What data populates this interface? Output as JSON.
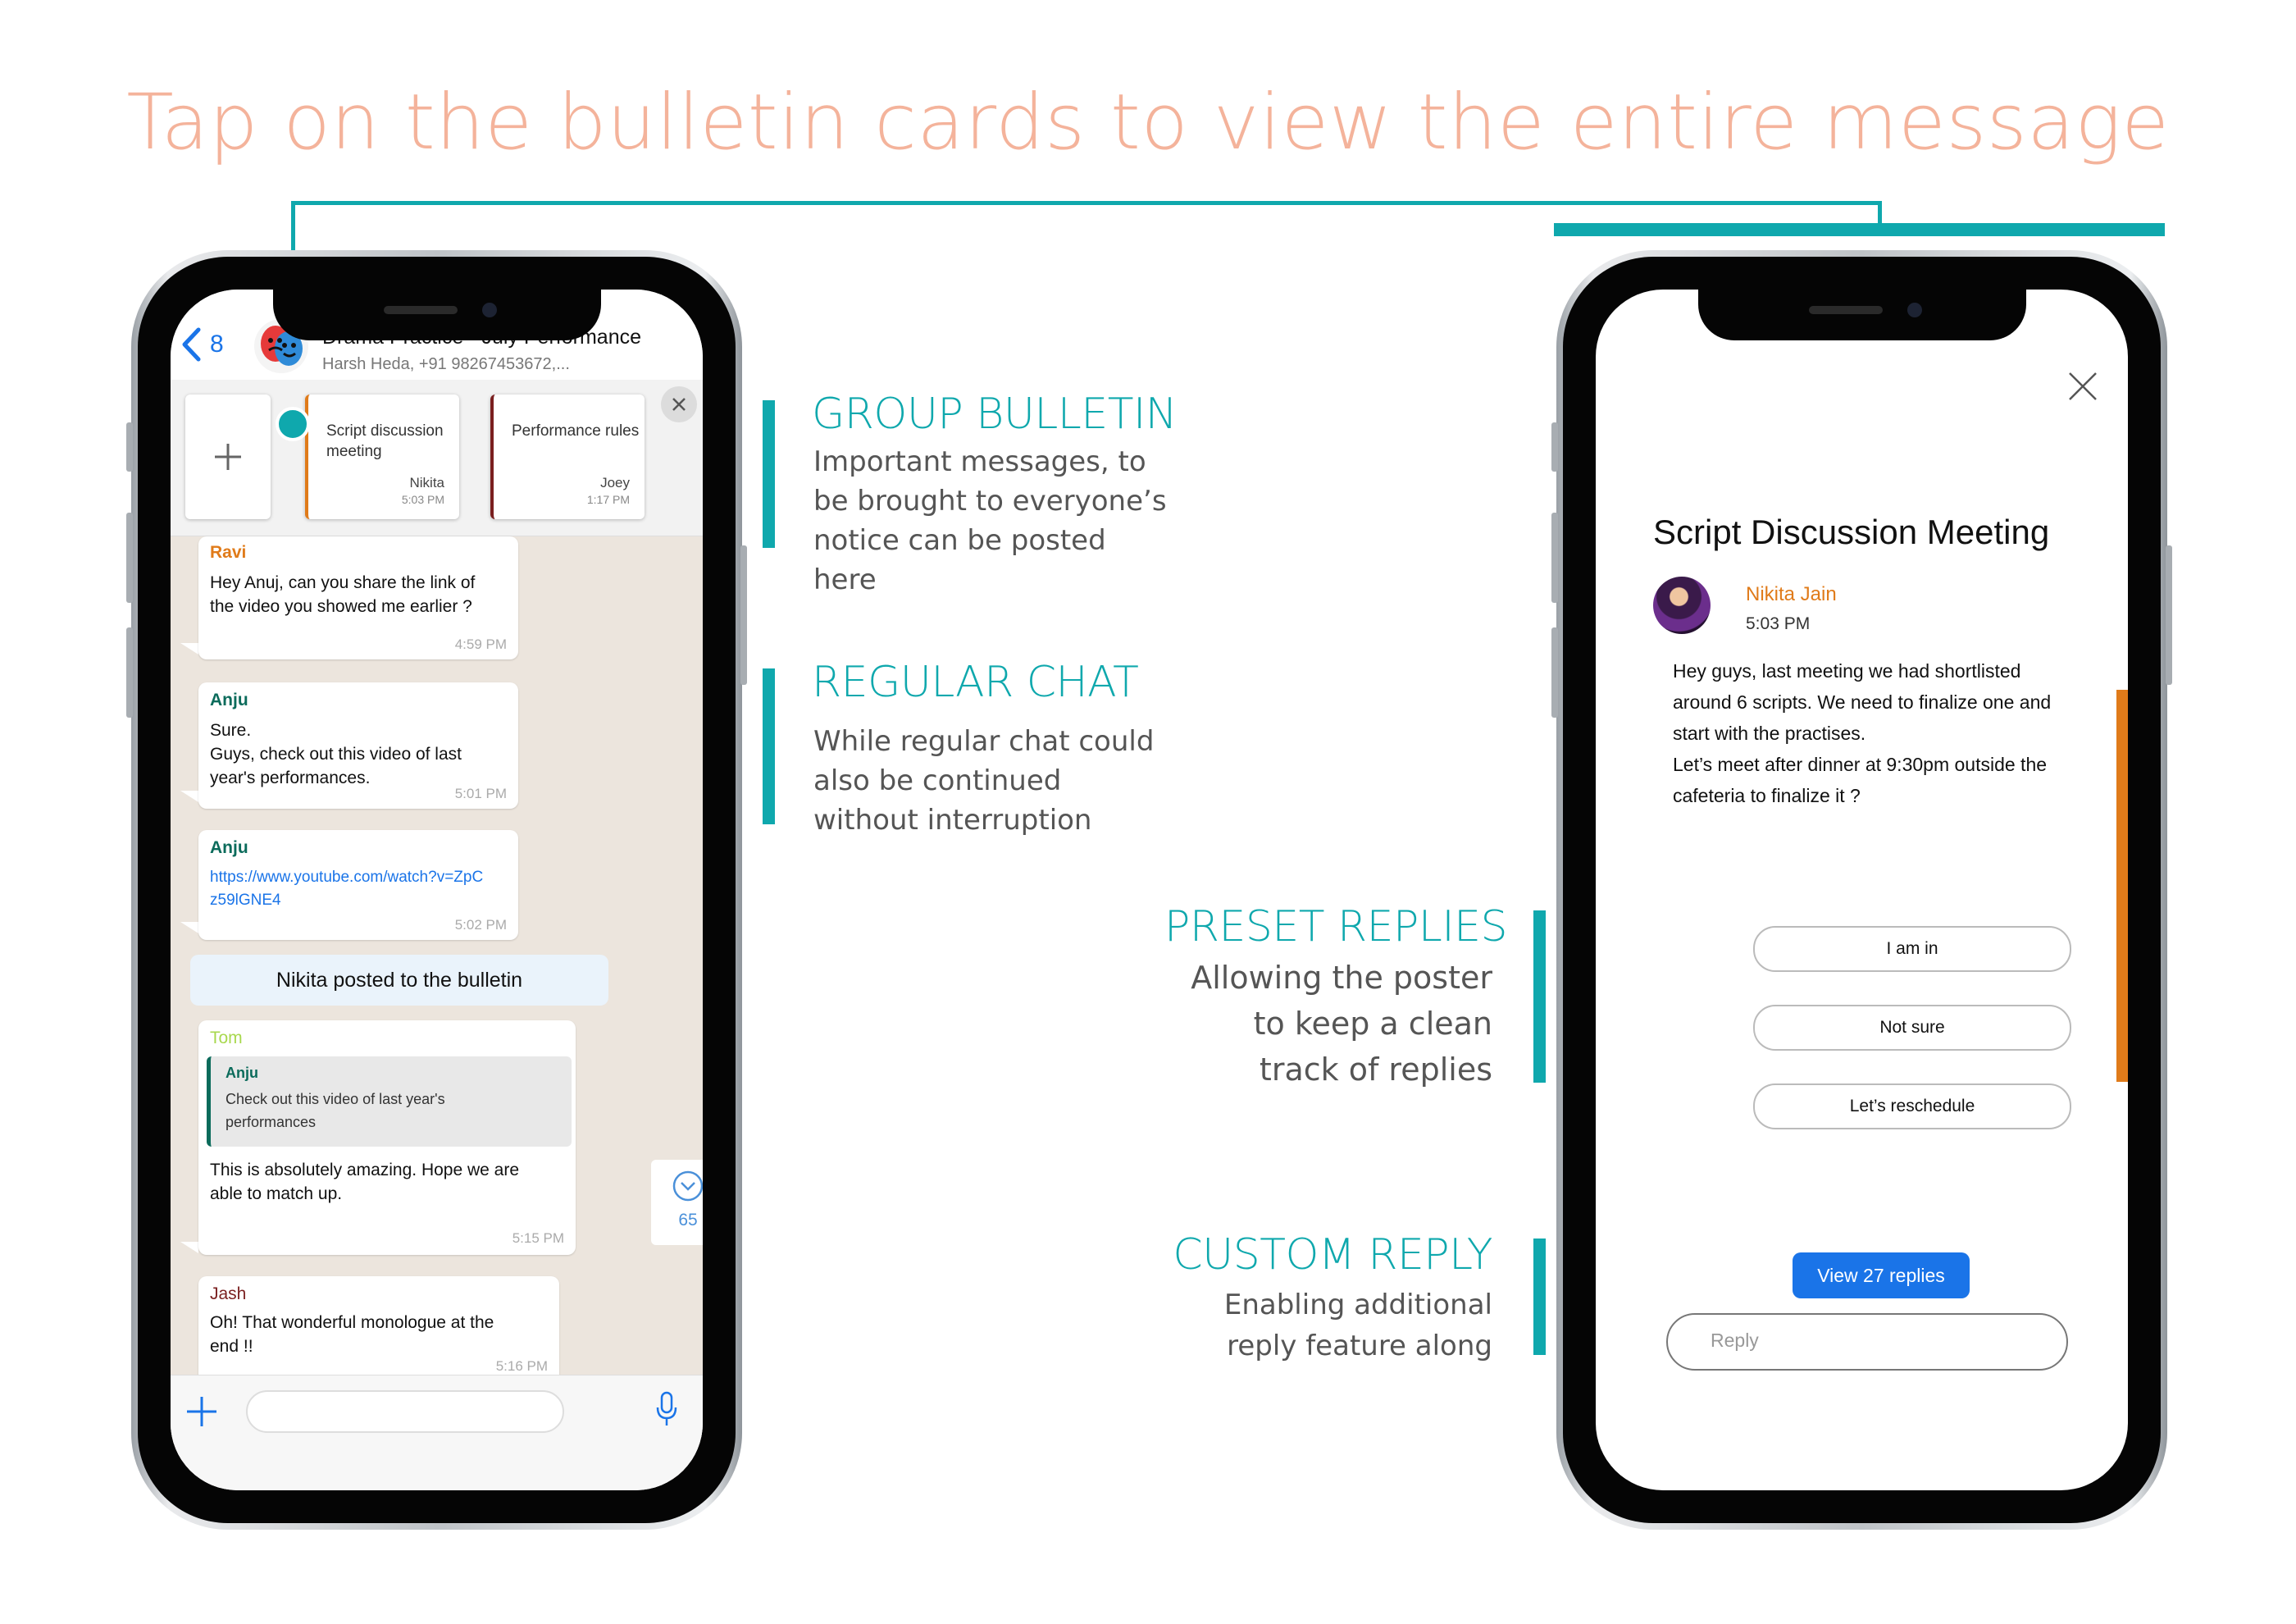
{
  "headline": "Tap on the bulletin cards to view the entire message",
  "colors": {
    "accent_teal": "#0fa8ad",
    "headline": "#f4b39b",
    "orange": "#e07b1a",
    "ios_blue": "#1a74e8"
  },
  "left_phone": {
    "header": {
      "back_count": "8",
      "group_name": "Drama Practice - July Performance",
      "members": "Harsh Heda, +91 98267453672,..."
    },
    "bulletins": [
      {
        "title": "Script discussion meeting",
        "author": "Nikita",
        "time": "5:03 PM",
        "accent": "#e07b1a"
      },
      {
        "title": "Performance rules",
        "author": "Joey",
        "time": "1:17 PM",
        "accent": "#7a1f1f"
      }
    ],
    "messages": [
      {
        "sender": "Ravi",
        "sender_color": "#e07b1a",
        "text": "Hey Anuj, can you share the link of the video you showed me earlier ?",
        "time": "4:59 PM"
      },
      {
        "sender": "Anju",
        "sender_color": "#0b6b5b",
        "text": "Sure.\nGuys, check out this video of last year's performances.",
        "time": "5:01 PM"
      },
      {
        "sender": "Anju",
        "sender_color": "#0b6b5b",
        "link": "https://www.youtube.com/watch?v=ZpCz59lGNE4",
        "time": "5:02 PM"
      },
      {
        "sender": "Tom",
        "sender_color": "#a8d84e",
        "quote_sender": "Anju",
        "quote_text": "Check out this video of last year's performances",
        "text": "This is absolutely amazing. Hope we are able to match up.",
        "time": "5:15 PM"
      },
      {
        "sender": "Jash",
        "sender_color": "#7a1f1f",
        "text": "Oh! That wonderful monologue at the end !!",
        "time": "5:16 PM"
      }
    ],
    "system_notice": "Nikita posted to the bulletin",
    "unread_count": "65"
  },
  "right_phone": {
    "title": "Script Discussion Meeting",
    "author": "Nikita Jain",
    "time": "5:03 PM",
    "body": "Hey guys, last meeting we had shortlisted around 6 scripts. We need to finalize one and start with the practises.\nLet’s meet after dinner at 9:30pm outside the cafeteria to finalize it ?",
    "preset_replies": [
      "I am in",
      "Not sure",
      "Let’s reschedule"
    ],
    "view_replies": "View 27 replies",
    "reply_placeholder": "Reply"
  },
  "annotations": {
    "group_bulletin": {
      "title": "GROUP BULLETIN",
      "desc": "Important messages, to be brought to everyone’s notice can be posted here"
    },
    "regular_chat": {
      "title": "REGULAR CHAT",
      "desc": "While regular chat could also be continued without interruption"
    },
    "preset_replies": {
      "title": "PRESET REPLIES",
      "desc": "Allowing the poster to keep a clean track of replies"
    },
    "custom_reply": {
      "title": "CUSTOM REPLY",
      "desc": "Enabling additional reply feature along"
    }
  }
}
